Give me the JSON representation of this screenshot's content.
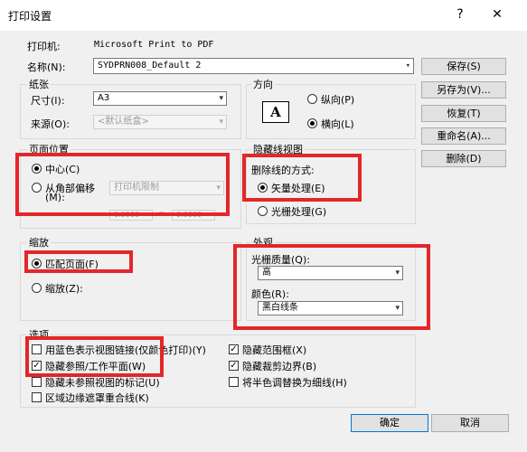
{
  "window": {
    "title": "打印设置",
    "help_icon": "?",
    "close_icon": "✕"
  },
  "printer": {
    "printer_label": "打印机:",
    "printer_value": "Microsoft Print to PDF",
    "name_label": "名称(N):",
    "name_value": "SYDPRN008_Default 2"
  },
  "side_buttons": {
    "save": "保存(S)",
    "save_as": "另存为(V)...",
    "restore": "恢复(T)",
    "rename": "重命名(A)...",
    "delete": "删除(D)"
  },
  "paper": {
    "group_label": "纸张",
    "size_label": "尺寸(I):",
    "size_value": "A3",
    "source_label": "来源(O):",
    "source_value": "<默认纸盒>"
  },
  "orientation": {
    "group_label": "方向",
    "portrait": "纵向(P)",
    "landscape": "横向(L)",
    "selected": "landscape",
    "preview_letter": "A"
  },
  "page_position": {
    "group_label": "页面位置",
    "center": "中心(C)",
    "offset_line1": "从角部偏移",
    "offset_line2": "(M):",
    "offset_select": "打印机限制",
    "selected": "center",
    "x_value": "0.0000",
    "x_label": "x",
    "y_value": "0.0000"
  },
  "hidden_line": {
    "group_label": "隐藏线视图",
    "method_label": "删除线的方式:",
    "vector": "矢量处理(E)",
    "raster": "光栅处理(G)",
    "selected": "vector"
  },
  "zoom": {
    "group_label": "缩放",
    "fit_page": "匹配页面(F)",
    "zoom": "缩放(Z):",
    "selected": "fit_page"
  },
  "appearance": {
    "group_label": "外观",
    "raster_quality_label": "光栅质量(Q):",
    "raster_quality_value": "高",
    "color_label": "颜色(R):",
    "color_value": "黑白线条"
  },
  "options": {
    "group_label": "选项",
    "left": [
      {
        "label": "用蓝色表示视图链接(仅颜色打印)(Y)",
        "checked": false
      },
      {
        "label": "隐藏参照/工作平面(W)",
        "checked": true
      },
      {
        "label": "隐藏未参照视图的标记(U)",
        "checked": false
      },
      {
        "label": "区域边缘遮罩重合线(K)",
        "checked": false
      }
    ],
    "right": [
      {
        "label": "隐藏范围框(X)",
        "checked": true
      },
      {
        "label": "隐藏裁剪边界(B)",
        "checked": true
      },
      {
        "label": "将半色调替换为细线(H)",
        "checked": false
      }
    ]
  },
  "footer": {
    "ok": "确定",
    "cancel": "取消"
  },
  "colors": {
    "highlight": "#e3262a",
    "dialog_bg": "#f0f0f0",
    "primary_border": "#0078d7"
  }
}
